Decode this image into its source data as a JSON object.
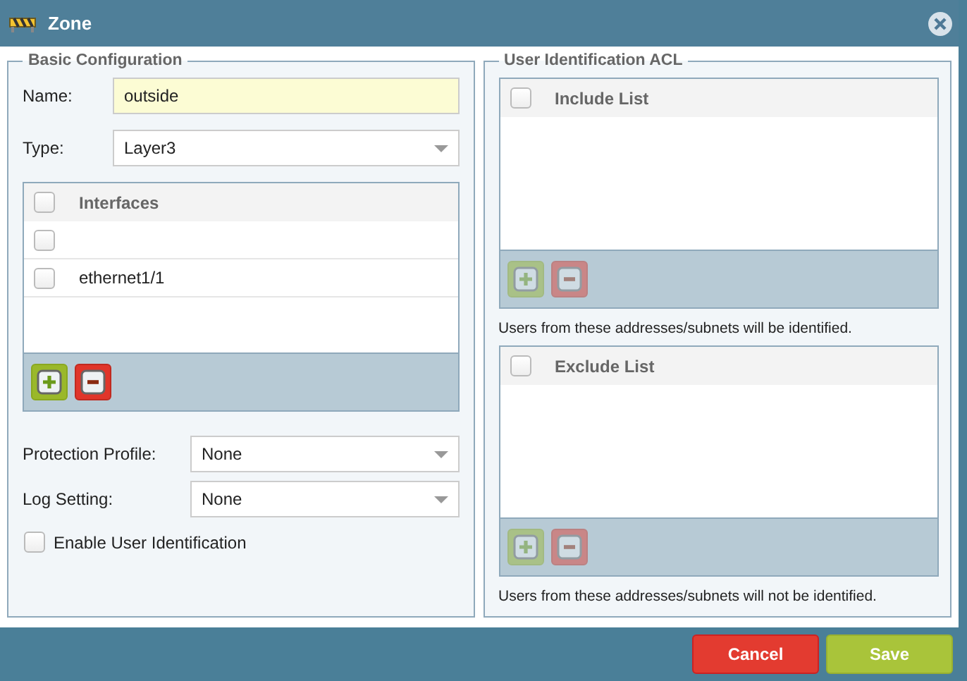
{
  "window": {
    "title": "Zone"
  },
  "basic_configuration": {
    "legend": "Basic Configuration",
    "name": {
      "label": "Name:",
      "value": "outside"
    },
    "type": {
      "label": "Type:",
      "value": "Layer3"
    },
    "interfaces": {
      "header": "Interfaces",
      "header_checked": false,
      "add_disabled": false,
      "remove_disabled": false,
      "rows": [
        {
          "checked": false
        },
        {
          "label": "ethernet1/1",
          "checked": false
        }
      ]
    },
    "protection_profile": {
      "label": "Protection Profile:",
      "value": "None"
    },
    "log_setting": {
      "label": "Log Setting:",
      "value": "None"
    },
    "enable_user_identification": {
      "label": "Enable User Identification",
      "checked": false
    }
  },
  "user_identification_acl": {
    "legend": "User Identification ACL",
    "lists": [
      {
        "header": "Include List",
        "header_checked": false,
        "add_disabled": true,
        "remove_disabled": true,
        "note": "Users from these addresses/subnets will be identified."
      },
      {
        "header": "Exclude List",
        "header_checked": false,
        "add_disabled": true,
        "remove_disabled": true,
        "note": "Users from these addresses/subnets will not be identified."
      }
    ]
  },
  "buttons": [
    {
      "label": "Cancel",
      "kind": "cancel"
    },
    {
      "label": "Save",
      "kind": "save"
    }
  ]
}
